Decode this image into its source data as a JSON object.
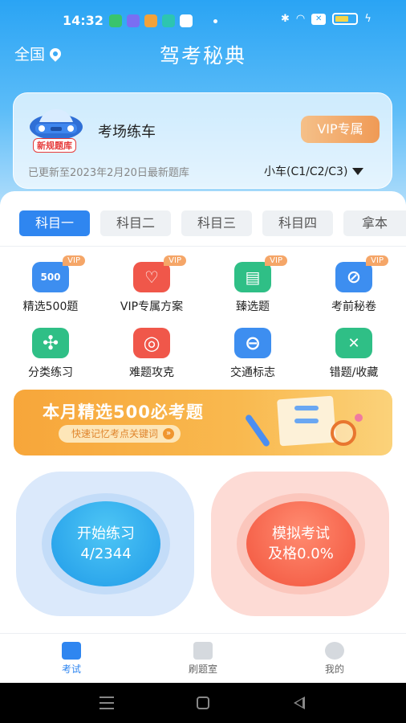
{
  "status_bar": {
    "time": "14:32",
    "close_badge": "✕"
  },
  "header": {
    "region": "全国",
    "title": "驾考秘典"
  },
  "card": {
    "title": "考场练车",
    "tag": "新规题库",
    "vip_button": "VIP专属",
    "updated": "已更新至2023年2月20日最新题库",
    "car_type": "小车(C1/C2/C3)"
  },
  "tabs": [
    "科目一",
    "科目二",
    "科目三",
    "科目四",
    "拿本"
  ],
  "features": [
    {
      "label": "精选500题",
      "icon_text": "500",
      "vip": "VIP",
      "icon": "list-500-icon",
      "color": "#3d8ef0"
    },
    {
      "label": "VIP专属方案",
      "icon_text": "♡",
      "vip": "VIP",
      "icon": "vip-plan-icon",
      "color": "#f0574a"
    },
    {
      "label": "臻选题",
      "icon_text": "▤",
      "vip": "VIP",
      "icon": "book-icon",
      "color": "#2fbf86"
    },
    {
      "label": "考前秘卷",
      "icon_text": "⊘",
      "vip": "VIP",
      "icon": "hidden-eye-icon",
      "color": "#3d8ef0"
    },
    {
      "label": "分类练习",
      "icon_text": "✣",
      "vip": "",
      "icon": "category-icon",
      "color": "#2fbf86"
    },
    {
      "label": "难题攻克",
      "icon_text": "◎",
      "vip": "",
      "icon": "target-icon",
      "color": "#f0574a"
    },
    {
      "label": "交通标志",
      "icon_text": "⊖",
      "vip": "",
      "icon": "traffic-sign-icon",
      "color": "#3d8ef0"
    },
    {
      "label": "错题/收藏",
      "icon_text": "✕",
      "vip": "",
      "icon": "wrong-collection-icon",
      "color": "#2fbf86"
    }
  ],
  "banner": {
    "title": "本月精选500必考题",
    "subtitle": "快速记忆考点关键词",
    "arrow": "»"
  },
  "practice": {
    "title": "开始练习",
    "progress": "4/2344"
  },
  "exam": {
    "title": "模拟考试",
    "pass_rate": "及格0.0%"
  },
  "tabbar": [
    "考试",
    "刷题室",
    "我的"
  ]
}
